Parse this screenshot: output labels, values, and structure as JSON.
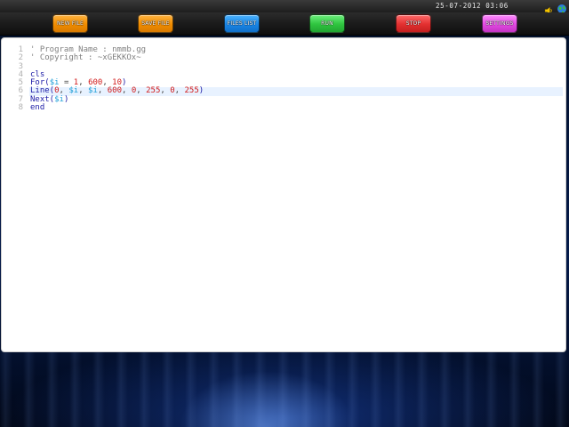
{
  "topbar": {
    "clock": "25-07-2012 03:06",
    "icons": [
      "speaker-icon",
      "globe-icon"
    ]
  },
  "toolbar": {
    "buttons": [
      {
        "label": "NEW FILE",
        "color": "#f08c00"
      },
      {
        "label": "SAVE FILE",
        "color": "#f08c00"
      },
      {
        "label": "FILES LIST",
        "color": "#1a86e6"
      },
      {
        "label": "RUN",
        "color": "#2fc43f"
      },
      {
        "label": "STOP",
        "color": "#e23030"
      },
      {
        "label": "SETTINGS",
        "color": "#e24ae2"
      }
    ]
  },
  "editor": {
    "line_numbers": [
      "1",
      "2",
      "3",
      "4",
      "5",
      "6",
      "7",
      "8"
    ],
    "active_line": 6,
    "lines": [
      [
        {
          "t": "' Program Name : nmmb.gg",
          "c": "comment"
        }
      ],
      [
        {
          "t": "' Copyright : ~xGEKKOx~",
          "c": "comment"
        }
      ],
      [],
      [
        {
          "t": "cls",
          "c": "kw"
        }
      ],
      [
        {
          "t": "For(",
          "c": "kw"
        },
        {
          "t": "$i",
          "c": "var"
        },
        {
          "t": " = ",
          "c": "op"
        },
        {
          "t": "1",
          "c": "num"
        },
        {
          "t": ", ",
          "c": "op"
        },
        {
          "t": "600",
          "c": "num"
        },
        {
          "t": ", ",
          "c": "op"
        },
        {
          "t": "10",
          "c": "num"
        },
        {
          "t": ")",
          "c": "kw"
        }
      ],
      [
        {
          "t": "Line(",
          "c": "kw"
        },
        {
          "t": "0",
          "c": "num"
        },
        {
          "t": ", ",
          "c": "op"
        },
        {
          "t": "$i",
          "c": "var"
        },
        {
          "t": ", ",
          "c": "op"
        },
        {
          "t": "$i",
          "c": "var"
        },
        {
          "t": ", ",
          "c": "op"
        },
        {
          "t": "600",
          "c": "num"
        },
        {
          "t": ", ",
          "c": "op"
        },
        {
          "t": "0",
          "c": "num"
        },
        {
          "t": ", ",
          "c": "op"
        },
        {
          "t": "255",
          "c": "num"
        },
        {
          "t": ", ",
          "c": "op"
        },
        {
          "t": "0",
          "c": "num"
        },
        {
          "t": ", ",
          "c": "op"
        },
        {
          "t": "255",
          "c": "num"
        },
        {
          "t": ")",
          "c": "kw"
        }
      ],
      [
        {
          "t": "Next(",
          "c": "kw"
        },
        {
          "t": "$i",
          "c": "var"
        },
        {
          "t": ")",
          "c": "kw"
        }
      ],
      [
        {
          "t": "end",
          "c": "kw"
        }
      ]
    ]
  }
}
